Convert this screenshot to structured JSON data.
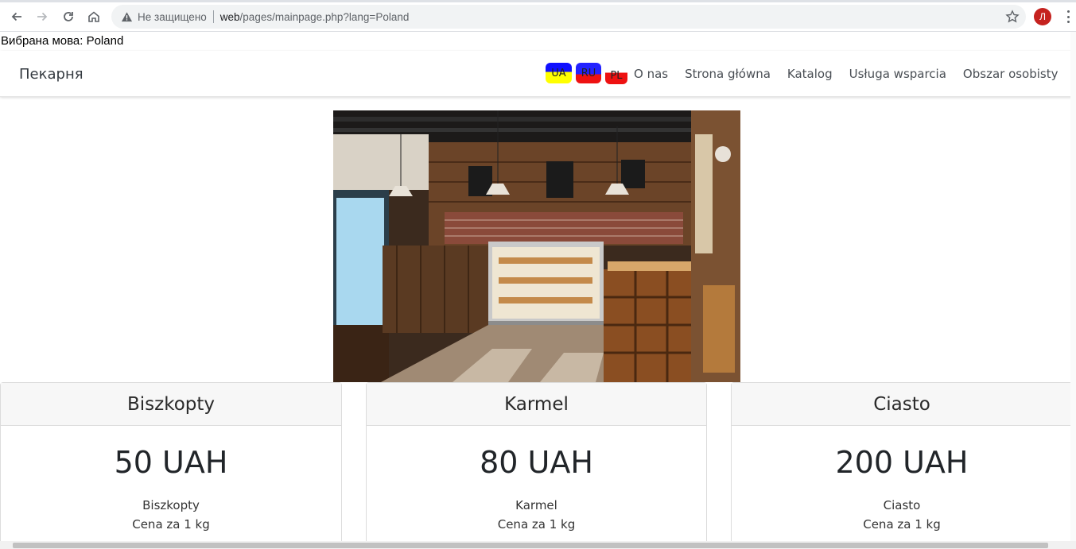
{
  "browser": {
    "security_label": "Не защищено",
    "url_host": "web",
    "url_path": "/pages/mainpage.php?lang=Poland",
    "profile_initial": "Л"
  },
  "page": {
    "selected_language_text": "Вибрана мова: Poland"
  },
  "navbar": {
    "brand": "Пекарня",
    "flags": [
      {
        "code": "UA"
      },
      {
        "code": "RU"
      },
      {
        "code": "PL"
      }
    ],
    "links": [
      {
        "label": "O nas"
      },
      {
        "label": "Strona główna"
      },
      {
        "label": "Katalog"
      },
      {
        "label": "Usługa wsparcia"
      },
      {
        "label": "Obszar osobisty"
      }
    ]
  },
  "products": [
    {
      "title": "Biszkopty",
      "price": "50 UAH",
      "name": "Biszkopty",
      "unit": "Cena za 1 kg"
    },
    {
      "title": "Karmel",
      "price": "80 UAH",
      "name": "Karmel",
      "unit": "Cena za 1 kg"
    },
    {
      "title": "Ciasto",
      "price": "200 UAH",
      "name": "Ciasto",
      "unit": "Cena za 1 kg"
    }
  ],
  "colors": {
    "avatar": "#c5221f",
    "card_header": "#f7f7f7"
  }
}
